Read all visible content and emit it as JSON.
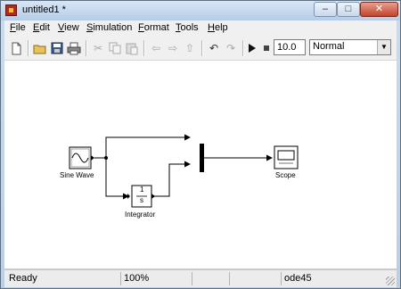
{
  "window": {
    "title": "untitled1 *",
    "controls": {
      "minimize": "–",
      "maximize": "□",
      "close": "✕"
    }
  },
  "menubar": {
    "items": [
      {
        "key": "F",
        "rest": "ile"
      },
      {
        "key": "E",
        "rest": "dit"
      },
      {
        "key": "V",
        "rest": "iew"
      },
      {
        "key": "S",
        "rest": "imulation"
      },
      {
        "key": "F",
        "rest": "ormat"
      },
      {
        "key": "T",
        "rest": "ools"
      },
      {
        "key": "H",
        "rest": "elp"
      }
    ]
  },
  "toolbar": {
    "icons": {
      "new": "new-document-icon",
      "open": "open-folder-icon",
      "save": "save-disk-icon",
      "print": "printer-icon",
      "cut": "cut-icon",
      "copy": "copy-icon",
      "paste": "paste-icon",
      "back": "back-arrow-icon",
      "forward": "forward-arrow-icon",
      "up": "up-arrow-icon",
      "undo": "undo-icon",
      "redo": "redo-icon",
      "start": "start-simulation-icon",
      "stop": "stop-simulation-icon"
    },
    "stop_time": "10.0",
    "sim_mode": "Normal"
  },
  "diagram": {
    "blocks": {
      "sine_wave": "Sine Wave",
      "integrator": "Integrator",
      "integrator_num": "1",
      "integrator_den": "s",
      "scope": "Scope",
      "mux": ""
    }
  },
  "status": {
    "state": "Ready",
    "zoom": "100%",
    "solver": "ode45"
  }
}
